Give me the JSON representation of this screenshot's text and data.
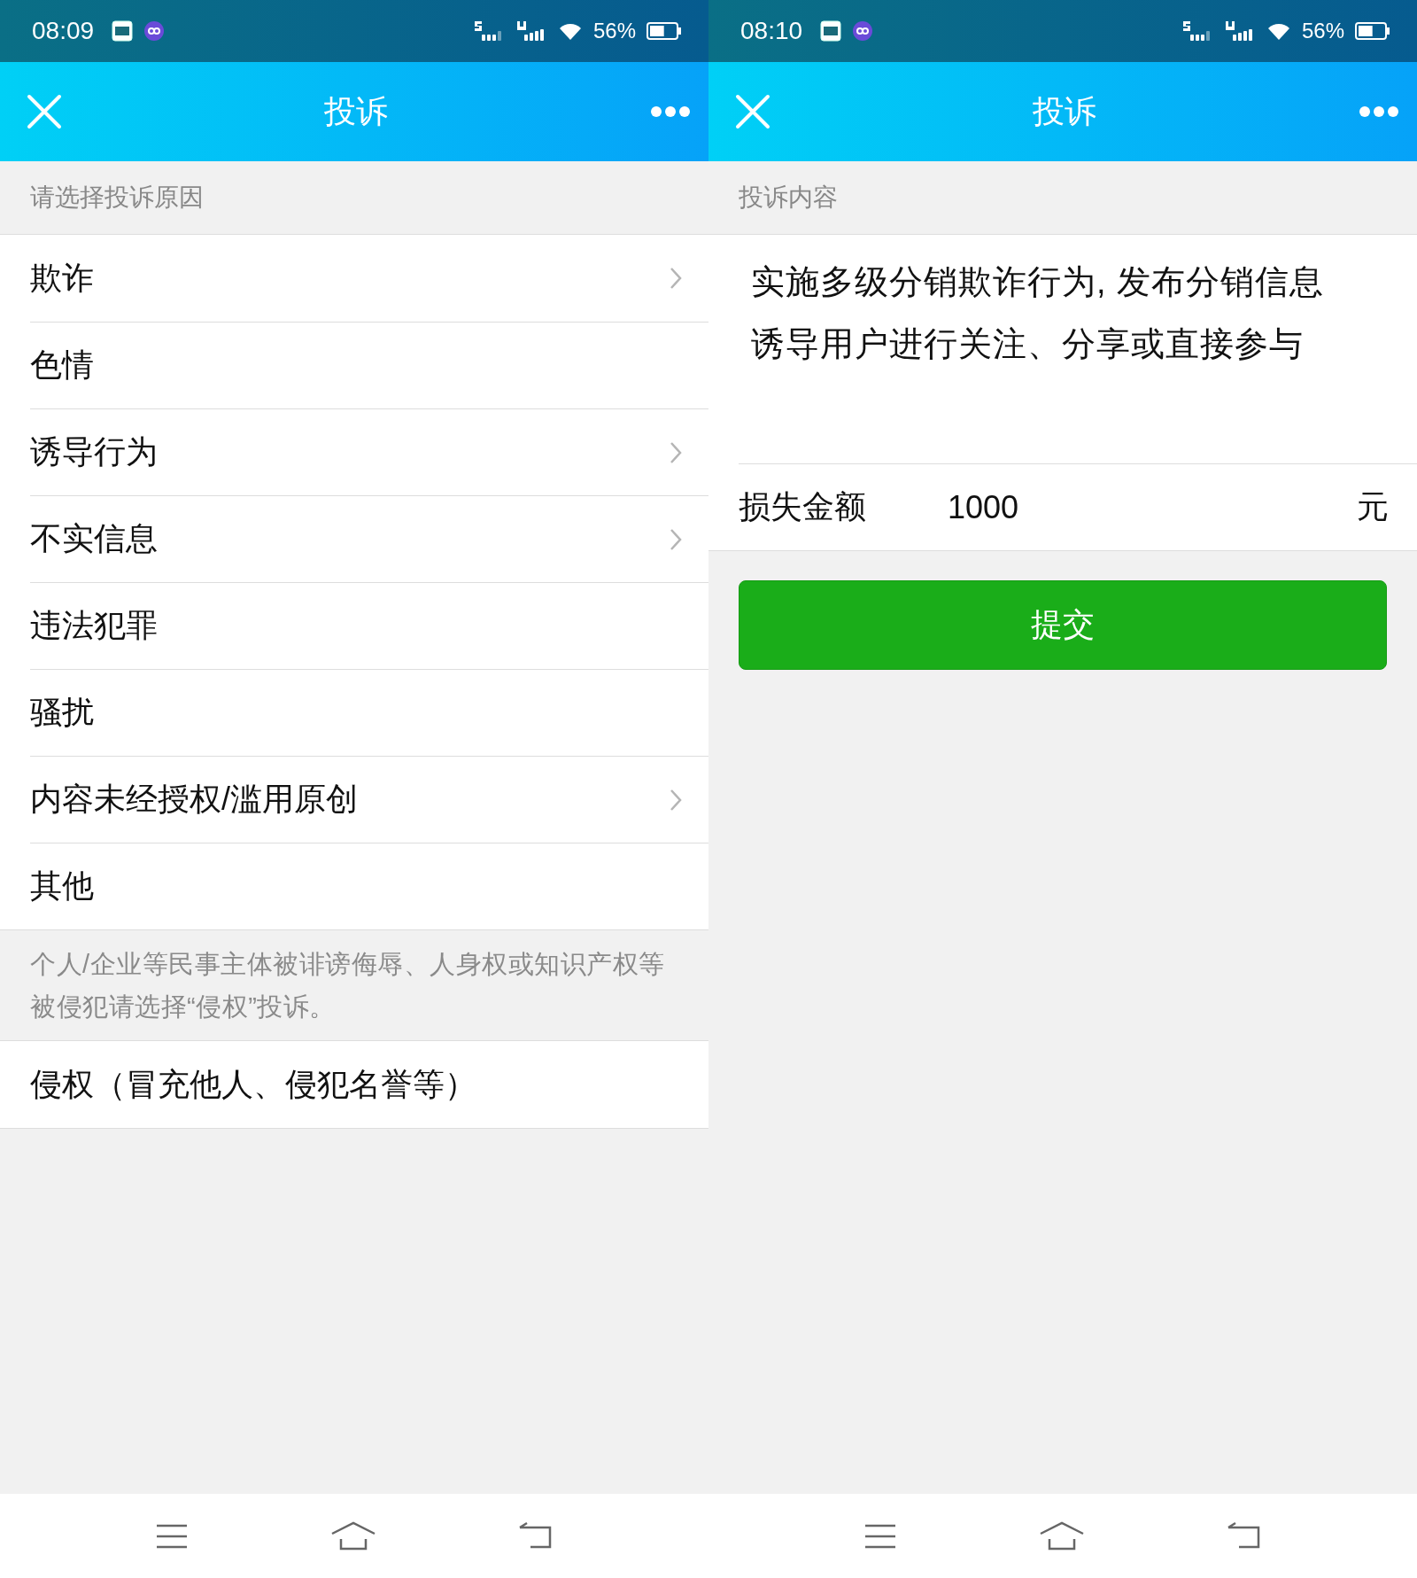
{
  "screens": [
    {
      "kind": "reason_list",
      "status_bar": {
        "time": "08:09",
        "battery": "56%"
      },
      "title": "投诉",
      "section_header": "请选择投诉原因",
      "reasons": [
        {
          "label": "欺诈",
          "arrow": true
        },
        {
          "label": "色情",
          "arrow": false
        },
        {
          "label": "诱导行为",
          "arrow": true
        },
        {
          "label": "不实信息",
          "arrow": true
        },
        {
          "label": "违法犯罪",
          "arrow": false
        },
        {
          "label": "骚扰",
          "arrow": false
        },
        {
          "label": "内容未经授权/滥用原创",
          "arrow": true
        },
        {
          "label": "其他",
          "arrow": false
        }
      ],
      "note": "个人/企业等民事主体被诽谤侮辱、人身权或知识产权等被侵犯请选择“侵权”投诉。",
      "extra_reasons": [
        {
          "label": "侵权（冒充他人、侵犯名誉等）",
          "arrow": false
        }
      ]
    },
    {
      "kind": "complaint_form",
      "status_bar": {
        "time": "08:10",
        "battery": "56%"
      },
      "title": "投诉",
      "section_header": "投诉内容",
      "content_lines": [
        "实施多级分销欺诈行为, 发布分销信息",
        "诱导用户进行关注、分享或直接参与"
      ],
      "amount": {
        "label": "损失金额",
        "value": "1000",
        "unit": "元"
      },
      "submit_button": "提交"
    }
  ]
}
